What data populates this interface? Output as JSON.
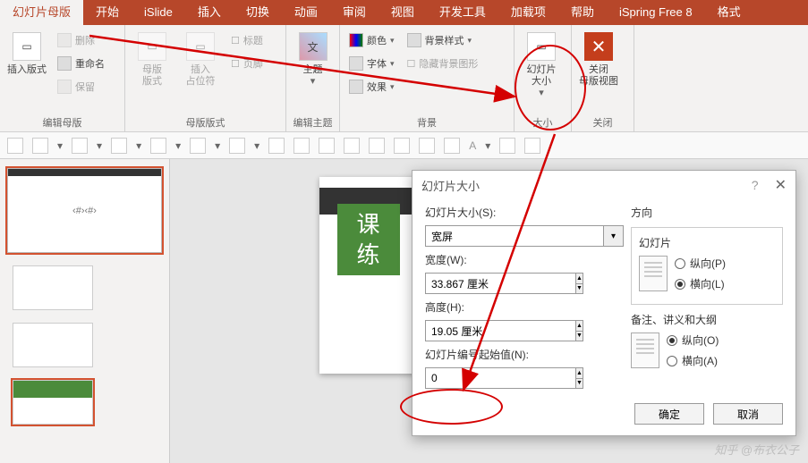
{
  "tabs": {
    "t0": "幻灯片母版",
    "t1": "开始",
    "t2": "iSlide",
    "t3": "插入",
    "t4": "切换",
    "t5": "动画",
    "t6": "审阅",
    "t7": "视图",
    "t8": "开发工具",
    "t9": "加载项",
    "t10": "帮助",
    "t11": "iSpring Free 8",
    "t12": "格式"
  },
  "ribbon": {
    "g1_label": "编辑母版",
    "insert_layout": "插入版式",
    "delete": "删除",
    "rename": "重命名",
    "keep": "保留",
    "g2_label": "母版版式",
    "master_layout": "母版\n版式",
    "insert_ph": "插入\n占位符",
    "title": "标题",
    "footer": "页脚",
    "g3_label": "编辑主题",
    "theme": "主题",
    "g4_label": "背景",
    "color": "颜色",
    "font": "字体",
    "effect": "效果",
    "bg_style": "背景样式",
    "hide_bg": "隐藏背景图形",
    "g5_label": "大小",
    "slide_size": "幻灯片\n大小",
    "g6_label": "关闭",
    "close_master": "关闭\n母版视图"
  },
  "slide": {
    "g1": "课",
    "g2": "练"
  },
  "thumb_text": "‹#›‹#›",
  "dialog": {
    "title": "幻灯片大小",
    "size_lbl": "幻灯片大小(S):",
    "size_val": "宽屏",
    "width_lbl": "宽度(W):",
    "width_val": "33.867 厘米",
    "height_lbl": "高度(H):",
    "height_val": "19.05 厘米",
    "start_lbl": "幻灯片编号起始值(N):",
    "start_val": "0",
    "orient_lbl": "方向",
    "slides_lbl": "幻灯片",
    "portrait": "纵向(P)",
    "landscape": "横向(L)",
    "notes_lbl": "备注、讲义和大纲",
    "portrait2": "纵向(O)",
    "landscape2": "横向(A)",
    "ok": "确定",
    "cancel": "取消"
  },
  "watermark": "知乎 @布衣公子"
}
